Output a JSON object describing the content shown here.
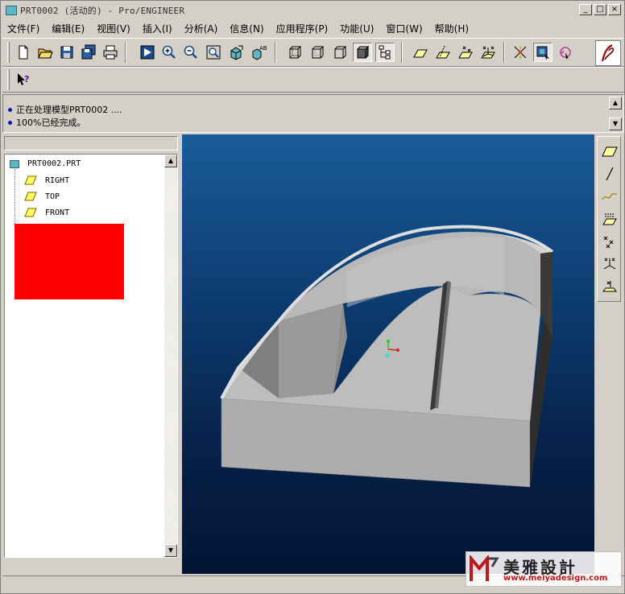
{
  "window": {
    "title": "PRT0002 (活动的) - Pro/ENGINEER",
    "buttons": [
      "_",
      "□",
      "×"
    ]
  },
  "menubar": {
    "items": [
      "文件(F)",
      "编辑(E)",
      "视图(V)",
      "插入(I)",
      "分析(A)",
      "信息(N)",
      "应用程序(P)",
      "功能(U)",
      "窗口(W)",
      "帮助(H)"
    ]
  },
  "messages": [
    "正在处理模型PRT0002 ....",
    "100%已经完成。"
  ],
  "model_tree": {
    "root": "PRT0002.PRT",
    "items": [
      "RIGHT",
      "TOP",
      "FRONT"
    ]
  },
  "icons": {
    "toolbar": [
      "new-file-icon",
      "open-folder-icon",
      "save-icon",
      "save-copy-icon",
      "print-icon",
      "play-icon",
      "zoom-in-icon",
      "zoom-out-icon",
      "zoom-fit-icon",
      "reorient-icon",
      "saved-views-icon",
      "wireframe-icon",
      "hidden-line-icon",
      "no-hidden-icon",
      "shaded-icon",
      "model-tree-icon",
      "datum-plane-display-icon",
      "datum-axis-display-icon",
      "datum-point-display-icon",
      "coord-sys-display-icon",
      "spin-center-icon",
      "repaint-icon",
      "orient-mode-icon",
      "pe-logo-icon",
      "context-help-icon"
    ],
    "datum_tools": [
      "datum-plane-tool-icon",
      "datum-axis-tool-icon",
      "datum-curve-tool-icon",
      "sketch-tool-icon",
      "datum-point-tool-icon",
      "coord-sys-tool-icon",
      "analysis-feature-icon"
    ]
  },
  "watermark": {
    "name": "美雅設計",
    "url": "www.meiyadesign.com"
  },
  "colors": {
    "viewport_top": "#1a5c9a",
    "viewport_bottom": "#041535",
    "model_gray": "#a8a8a8",
    "highlight_box": "#ff0000"
  }
}
